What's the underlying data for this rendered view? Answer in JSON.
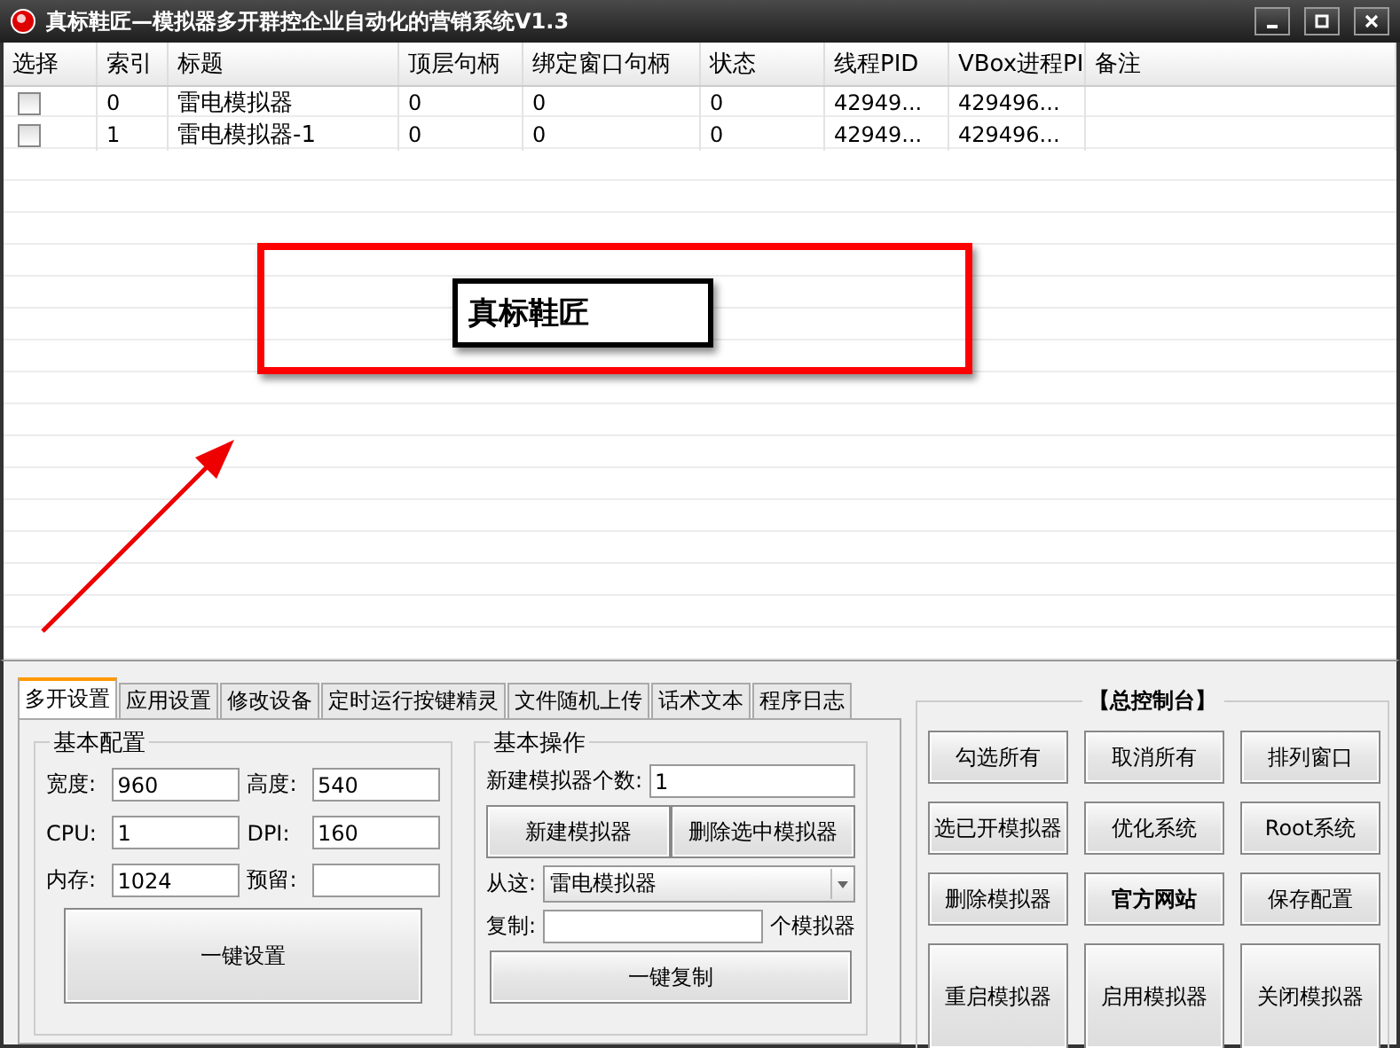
{
  "window": {
    "title": "真标鞋匠—模拟器多开群控企业自动化的营销系统V1.3"
  },
  "table": {
    "columns": [
      "选择",
      "索引",
      "标题",
      "顶层句柄",
      "绑定窗口句柄",
      "状态",
      "线程PID",
      "VBox进程PI",
      "备注"
    ],
    "rows": [
      {
        "checked": false,
        "cells": [
          "",
          "0",
          "雷电模拟器",
          "0",
          "0",
          "0",
          "42949...",
          "429496..."
        ]
      },
      {
        "checked": false,
        "cells": [
          "",
          "1",
          "雷电模拟器-1",
          "0",
          "0",
          "0",
          "42949...",
          "429496..."
        ]
      }
    ]
  },
  "annotation": {
    "label": "真标鞋匠"
  },
  "tabs": [
    {
      "label": "多开设置",
      "selected": true
    },
    {
      "label": "应用设置",
      "selected": false
    },
    {
      "label": "修改设备",
      "selected": false
    },
    {
      "label": "定时运行按键精灵",
      "selected": false
    },
    {
      "label": "文件随机上传",
      "selected": false
    },
    {
      "label": "话术文本",
      "selected": false
    },
    {
      "label": "程序日志",
      "selected": false
    }
  ],
  "basic_config": {
    "title": "基本配置",
    "fields": [
      {
        "label": "宽度:",
        "value": "960"
      },
      {
        "label": "高度:",
        "value": "540"
      },
      {
        "label": "CPU:",
        "value": "1"
      },
      {
        "label": "DPI:",
        "value": "160"
      },
      {
        "label": "内存:",
        "value": "1024"
      },
      {
        "label": "预留:"
      }
    ],
    "button": "一键设置"
  },
  "basic_ops": {
    "title": "基本操作",
    "count_label": "新建模拟器个数:",
    "count_value": "1",
    "buttons": [
      "新建模拟器",
      "删除选中模拟器"
    ],
    "from_label": "从这:",
    "from_value": "雷电模拟器",
    "copy_label": "复制:",
    "copy_suffix": "个模拟器",
    "copy_button": "一键复制"
  },
  "console": {
    "title": "【总控制台】",
    "buttons": [
      {
        "label": "勾选所有",
        "bold": false
      },
      {
        "label": "取消所有",
        "bold": false
      },
      {
        "label": "排列窗口",
        "bold": false
      },
      {
        "label": "选已开模拟器",
        "bold": false
      },
      {
        "label": "优化系统",
        "bold": false
      },
      {
        "label": "Root系统",
        "bold": false
      },
      {
        "label": "删除模拟器",
        "bold": false
      },
      {
        "label": "官方网站",
        "bold": true
      },
      {
        "label": "保存配置",
        "bold": false
      },
      {
        "label": "重启模拟器",
        "bold": false
      },
      {
        "label": "启用模拟器",
        "bold": false
      },
      {
        "label": "关闭模拟器",
        "bold": false
      }
    ]
  }
}
